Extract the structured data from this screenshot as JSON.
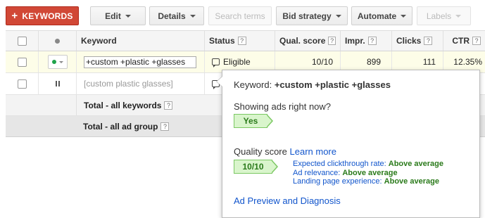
{
  "toolbar": {
    "add_keywords": "KEYWORDS",
    "edit": "Edit",
    "details": "Details",
    "search_terms": "Search terms",
    "bid_strategy": "Bid strategy",
    "automate": "Automate",
    "labels": "Labels"
  },
  "table": {
    "headers": {
      "keyword": "Keyword",
      "status": "Status",
      "qual_score": "Qual. score",
      "impr": "Impr.",
      "clicks": "Clicks",
      "ctr": "CTR",
      "help": "?"
    },
    "rows": [
      {
        "keyword": "+custom +plastic +glasses",
        "status": "Eligible",
        "qual_score": "10/10",
        "impr": "899",
        "clicks": "111",
        "ctr": "12.35%"
      },
      {
        "keyword": "[custom plastic glasses]"
      }
    ],
    "total_keywords": "Total - all keywords",
    "total_ad_group": "Total - all ad group"
  },
  "tooltip": {
    "keyword_label": "Keyword:",
    "keyword_value": "+custom +plastic +glasses",
    "showing_ads": "Showing ads right now?",
    "showing_value": "Yes",
    "quality_score_label": "Quality score",
    "learn_more": "Learn more",
    "quality_score_value": "10/10",
    "details": [
      {
        "label": "Expected clickthrough rate:",
        "value": "Above average"
      },
      {
        "label": "Ad relevance:",
        "value": "Above average"
      },
      {
        "label": "Landing page experience:",
        "value": "Above average"
      }
    ],
    "preview_link": "Ad Preview and Diagnosis"
  },
  "colors": {
    "primary_red": "#d14836",
    "eligible_green": "#1fa34a",
    "flag_green_bg": "#d9f5cc",
    "link_blue": "#1155cc"
  }
}
